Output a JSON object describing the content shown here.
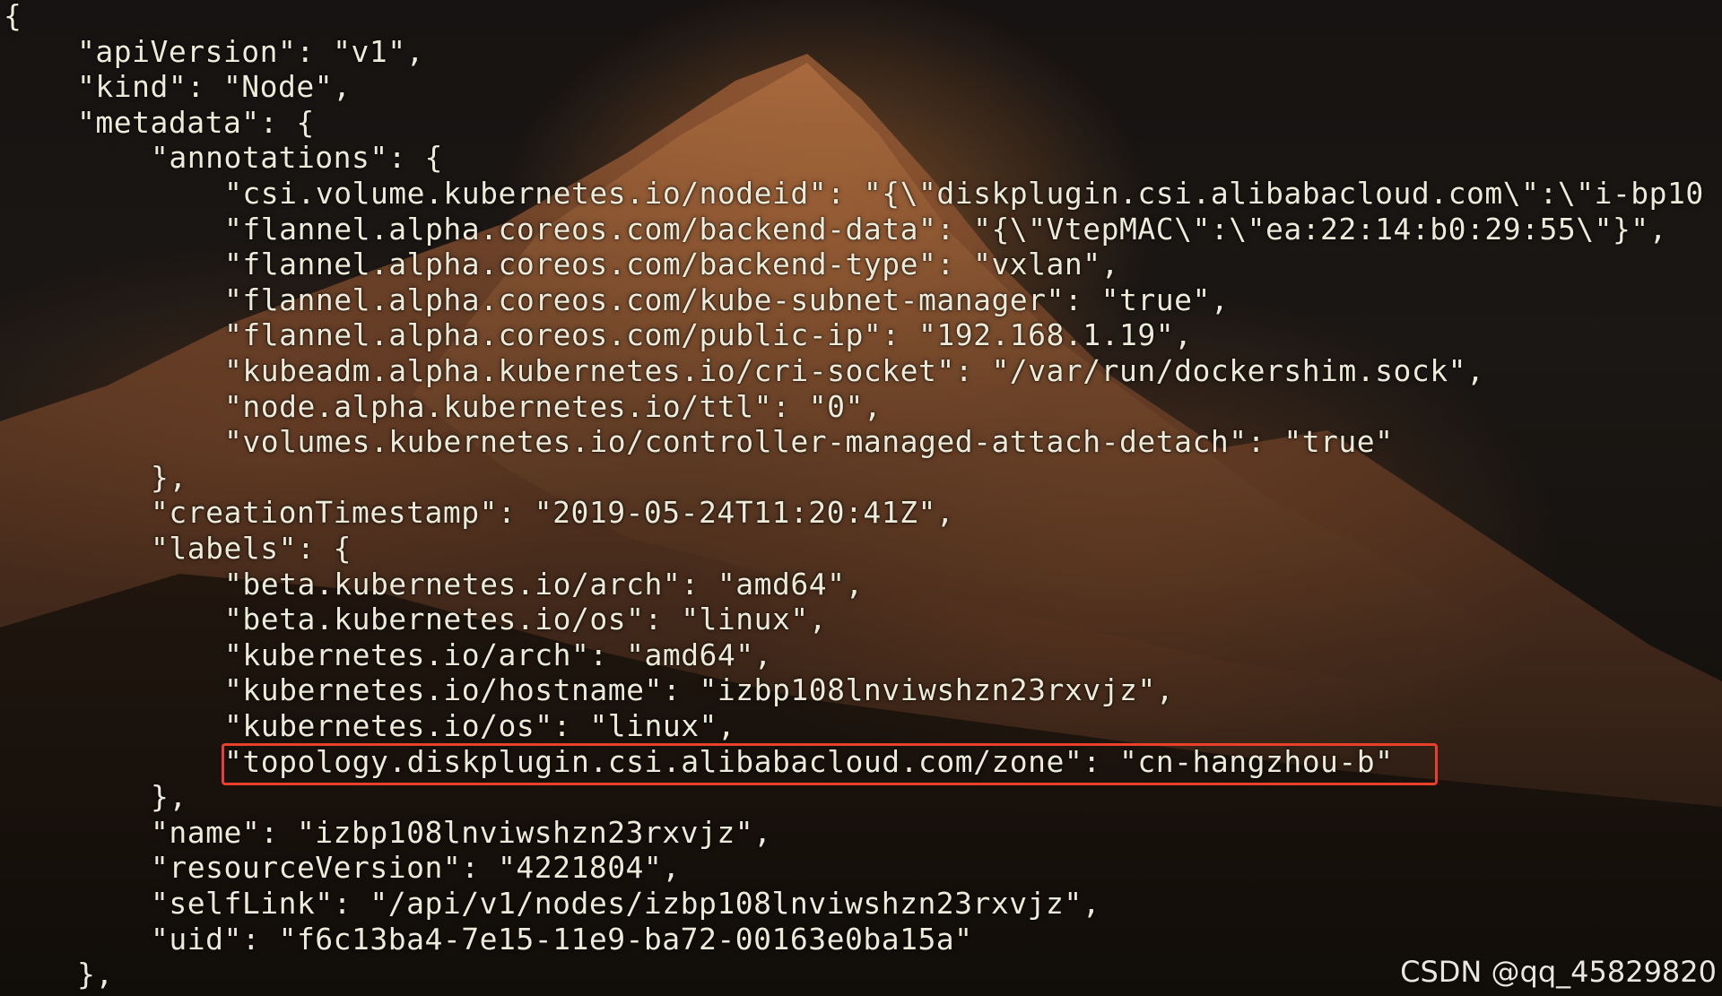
{
  "terminal": {
    "lines": [
      {
        "indent": 0,
        "text": "{"
      },
      {
        "indent": 4,
        "text": "\"apiVersion\": \"v1\","
      },
      {
        "indent": 4,
        "text": "\"kind\": \"Node\","
      },
      {
        "indent": 4,
        "text": "\"metadata\": {"
      },
      {
        "indent": 8,
        "text": "\"annotations\": {"
      },
      {
        "indent": 12,
        "text": "\"csi.volume.kubernetes.io/nodeid\": \"{\\\"diskplugin.csi.alibabacloud.com\\\":\\\"i-bp10"
      },
      {
        "indent": 12,
        "text": "\"flannel.alpha.coreos.com/backend-data\": \"{\\\"VtepMAC\\\":\\\"ea:22:14:b0:29:55\\\"}\","
      },
      {
        "indent": 12,
        "text": "\"flannel.alpha.coreos.com/backend-type\": \"vxlan\","
      },
      {
        "indent": 12,
        "text": "\"flannel.alpha.coreos.com/kube-subnet-manager\": \"true\","
      },
      {
        "indent": 12,
        "text": "\"flannel.alpha.coreos.com/public-ip\": \"192.168.1.19\","
      },
      {
        "indent": 12,
        "text": "\"kubeadm.alpha.kubernetes.io/cri-socket\": \"/var/run/dockershim.sock\","
      },
      {
        "indent": 12,
        "text": "\"node.alpha.kubernetes.io/ttl\": \"0\","
      },
      {
        "indent": 12,
        "text": "\"volumes.kubernetes.io/controller-managed-attach-detach\": \"true\""
      },
      {
        "indent": 8,
        "text": "},"
      },
      {
        "indent": 8,
        "text": "\"creationTimestamp\": \"2019-05-24T11:20:41Z\","
      },
      {
        "indent": 8,
        "text": "\"labels\": {"
      },
      {
        "indent": 12,
        "text": "\"beta.kubernetes.io/arch\": \"amd64\","
      },
      {
        "indent": 12,
        "text": "\"beta.kubernetes.io/os\": \"linux\","
      },
      {
        "indent": 12,
        "text": "\"kubernetes.io/arch\": \"amd64\","
      },
      {
        "indent": 12,
        "text": "\"kubernetes.io/hostname\": \"izbp108lnviwshzn23rxvjz\","
      },
      {
        "indent": 12,
        "text": "\"kubernetes.io/os\": \"linux\","
      },
      {
        "indent": 12,
        "text": "\"topology.diskplugin.csi.alibabacloud.com/zone\": \"cn-hangzhou-b\""
      },
      {
        "indent": 8,
        "text": "},"
      },
      {
        "indent": 8,
        "text": "\"name\": \"izbp108lnviwshzn23rxvjz\","
      },
      {
        "indent": 8,
        "text": "\"resourceVersion\": \"4221804\","
      },
      {
        "indent": 8,
        "text": "\"selfLink\": \"/api/v1/nodes/izbp108lnviwshzn23rxvjz\","
      },
      {
        "indent": 8,
        "text": "\"uid\": \"f6c13ba4-7e15-11e9-ba72-00163e0ba15a\""
      },
      {
        "indent": 4,
        "text": "},"
      }
    ],
    "highlighted_line": 21
  },
  "watermark": "CSDN @qq_45829820",
  "colors": {
    "text": "#ecead8",
    "highlight_border": "#e8402a",
    "background": "#171312"
  }
}
